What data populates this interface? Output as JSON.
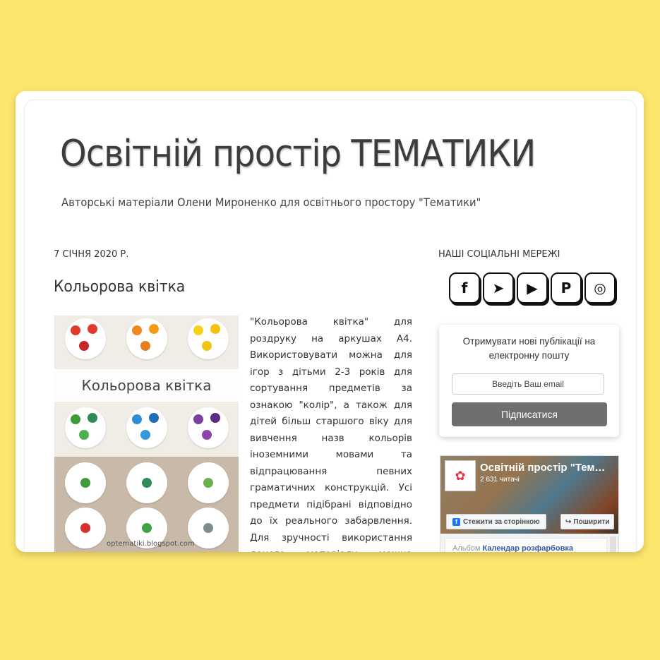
{
  "blog": {
    "title": "Освітній простір ТЕМАТИКИ",
    "description": "Авторські матеріали Олени Мироненко для освітнього простору \"Тематики\""
  },
  "post": {
    "date": "7 січня 2020 р.",
    "title": "Кольорова квітка",
    "image_banner": "Кольорова квітка",
    "image_watermark": "optematiki.blogspot.com",
    "body": "\"Кольорова квітка\" для роздруку на аркушах А4. Використовувати можна для ігор з дітьми 2-3 років для сортування предметів за ознакою \"колір\", а також для дітей більш старшого віку для вивчення назв кольорів іноземними мовами та відпрацювання певних граматичних конструкцій. Усі предмети підібрані відповідно до їх реального забарвлення. Для зручності використання даного матеріалу можна заламінувати вирізані елементи та використовувати липучки."
  },
  "sidebar": {
    "social_heading": "Наші соціальні мережі",
    "social": [
      {
        "name": "facebook",
        "glyph": "f"
      },
      {
        "name": "telegram",
        "glyph": "➤"
      },
      {
        "name": "youtube",
        "glyph": "▶"
      },
      {
        "name": "pinterest",
        "glyph": "P"
      },
      {
        "name": "instagram",
        "glyph": "◎"
      }
    ],
    "subscribe": {
      "text": "Отримувати нові публікації на електронну пошту",
      "placeholder": "Введіть Ваш email",
      "button": "Підписатися"
    },
    "facebook": {
      "page_name": "Освітній простір \"Тематики\"",
      "followers": "2 631 читачі",
      "follow_label": "Стежити за сторінкою",
      "share_label": "Поширити",
      "album_prefix": "Альбом",
      "album_name": "Календар розфарбовка"
    }
  },
  "colors": {
    "background": "#fce56d",
    "subscribe_button": "#6f6f6f",
    "facebook_blue": "#1877f2"
  }
}
